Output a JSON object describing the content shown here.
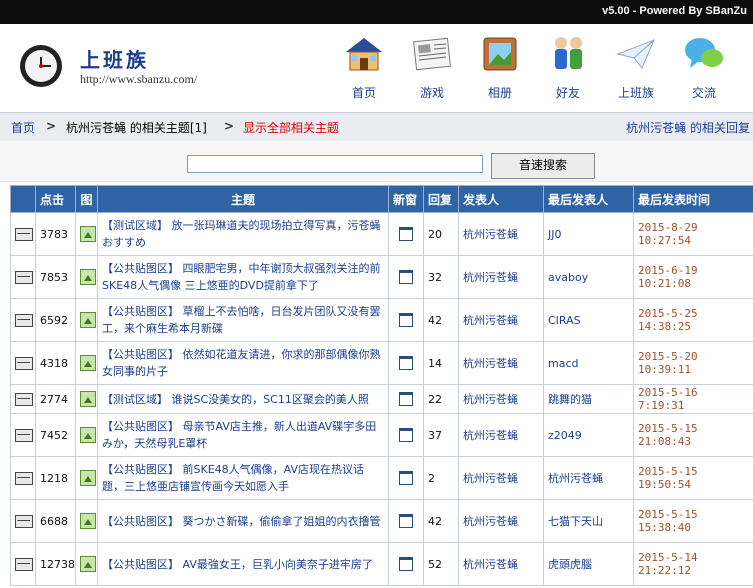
{
  "topbar": {
    "version_text": "v5.00 - Powered By SBanZu"
  },
  "site": {
    "name": "上班族",
    "url": "http://www.sbanzu.com/"
  },
  "nav": [
    {
      "label": "首页",
      "icon": "house-icon"
    },
    {
      "label": "游戏",
      "icon": "newspaper-icon"
    },
    {
      "label": "相册",
      "icon": "picture-frame-icon"
    },
    {
      "label": "好友",
      "icon": "friends-icon"
    },
    {
      "label": "上班族",
      "icon": "paper-plane-icon"
    },
    {
      "label": "交流",
      "icon": "chat-bubble-icon"
    }
  ],
  "breadcrumb": {
    "home": "首页",
    "sep": ">",
    "current": "杭州污苍蝇 的相关主题[1]",
    "show_all": "显示全部相关主题",
    "right": "杭州污苍蝇 的相关回复"
  },
  "search": {
    "value": "",
    "button": "音速搜索"
  },
  "table": {
    "headers": [
      "点击",
      "图",
      "主题",
      "新窗",
      "回复",
      "发表人",
      "最后发表人",
      "最后发表时间"
    ],
    "rows": [
      {
        "icon": "envelope-icon",
        "clicks": "3783",
        "tag": "【测试区域】",
        "title": "放一张玛琳道夫的现场拍立得写真，污苍蝇おすすめ",
        "replies": "20",
        "author": "杭州污苍蝇",
        "last": "JJ0",
        "time": "2015-8-29 10:27:54"
      },
      {
        "icon": "envelope-icon",
        "clicks": "7853",
        "tag": "【公共贴图区】",
        "title": "四眼肥宅男，中年谢顶大叔强烈关注的前SKE48人气偶像 三上悠亜的DVD提前拿下了",
        "replies": "32",
        "author": "杭州污苍蝇",
        "last": "avaboy",
        "time": "2015-6-19 10:21:08"
      },
      {
        "icon": "envelope-icon",
        "clicks": "6592",
        "tag": "【公共贴图区】",
        "title": "草榴上不去怕啥，日台发片团队又没有罢工，来个麻生希本月新碟",
        "replies": "42",
        "author": "杭州污苍蝇",
        "last": "CIRAS",
        "time": "2015-5-25 14:38:25"
      },
      {
        "icon": "envelope-icon",
        "clicks": "4318",
        "tag": "【公共贴图区】",
        "title": "依然如花道友请进，你求的那部偶像你熟女同事的片子",
        "replies": "14",
        "author": "杭州污苍蝇",
        "last": "macd",
        "time": "2015-5-20 10:39:11"
      },
      {
        "icon": "envelope-icon",
        "clicks": "2774",
        "tag": "【测试区域】",
        "title": "谁说SC没美女的，SC11区聚会的美人照",
        "replies": "22",
        "author": "杭州污苍蝇",
        "last": "跳舞的猫",
        "time": "2015-5-16 7:19:31",
        "short": true
      },
      {
        "icon": "envelope-icon",
        "clicks": "7452",
        "tag": "【公共贴图区】",
        "title": "母亲节AV店主推，新人出道AV碟宇多田みか，天然母乳E罩杯",
        "replies": "37",
        "author": "杭州污苍蝇",
        "last": "z2049",
        "time": "2015-5-15 21:08:43"
      },
      {
        "icon": "envelope-icon",
        "clicks": "1218",
        "tag": "【公共贴图区】",
        "title": "前SKE48人气偶像，AV店现在热议话题，三上悠亜店铺宣传画今天如愿入手",
        "replies": "2",
        "author": "杭州污苍蝇",
        "last": "杭州污苍蝇",
        "time": "2015-5-15 19:50:54"
      },
      {
        "icon": "envelope-icon",
        "clicks": "6688",
        "tag": "【公共贴图区】",
        "title": "葵つかさ新碟，偷偷拿了姐姐的内衣撸管",
        "replies": "42",
        "author": "杭州污苍蝇",
        "last": "七猫下天山",
        "time": "2015-5-15 15:38:40"
      },
      {
        "icon": "envelope-icon",
        "clicks": "12738",
        "tag": "【公共贴图区】",
        "title": "AV最強女王，巨乳小向美奈子进牢房了",
        "replies": "52",
        "author": "杭州污苍蝇",
        "last": "虎頭虎腦",
        "time": "2015-5-14 21:22:12"
      }
    ]
  },
  "colors": {
    "header_blue": "#2e63a6",
    "link_blue": "#1b3f8f",
    "date_brown": "#a0522d",
    "red_link": "#e00000"
  }
}
